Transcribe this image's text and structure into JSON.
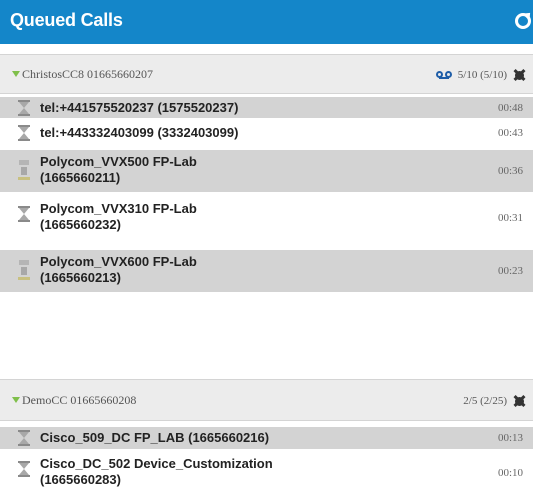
{
  "header": {
    "title": "Queued Calls",
    "refresh_icon": "refresh-icon",
    "color": "#1486c9"
  },
  "queues": [
    {
      "name": "ChristosCC8 01665660207",
      "counts": "5/10 (5/10)",
      "voicemail_icon": "voicemail-icon",
      "settings_icon": "settings-icon",
      "calls": [
        {
          "label_line1": "tel:+441575520237 (1575520237)",
          "label_line2": "",
          "time": "00:48",
          "icon": "hourglass-icon",
          "shaded": true
        },
        {
          "label_line1": "tel:+443332403099 (3332403099)",
          "label_line2": "",
          "time": "00:43",
          "icon": "hourglass-icon",
          "shaded": false
        },
        {
          "label_line1": "Polycom_VVX500 FP-Lab",
          "label_line2": "(1665660211)",
          "time": "00:36",
          "icon": "desk-phone-icon",
          "shaded": true
        },
        {
          "label_line1": "Polycom_VVX310 FP-Lab",
          "label_line2": "(1665660232)",
          "time": "00:31",
          "icon": "hourglass-icon",
          "shaded": false
        },
        {
          "label_line1": "Polycom_VVX600 FP-Lab",
          "label_line2": "(1665660213)",
          "time": "00:23",
          "icon": "desk-phone-icon",
          "shaded": true
        }
      ]
    },
    {
      "name": "DemoCC 01665660208",
      "counts": "2/5 (2/25)",
      "settings_icon": "settings-icon",
      "calls": [
        {
          "label_line1": "Cisco_509_DC FP_LAB (1665660216)",
          "label_line2": "",
          "time": "00:13",
          "icon": "hourglass-icon",
          "shaded": true
        },
        {
          "label_line1": "Cisco_DC_502 Device_Customization",
          "label_line2": "(1665660283)",
          "time": "00:10",
          "icon": "hourglass-icon",
          "shaded": false
        }
      ]
    }
  ]
}
